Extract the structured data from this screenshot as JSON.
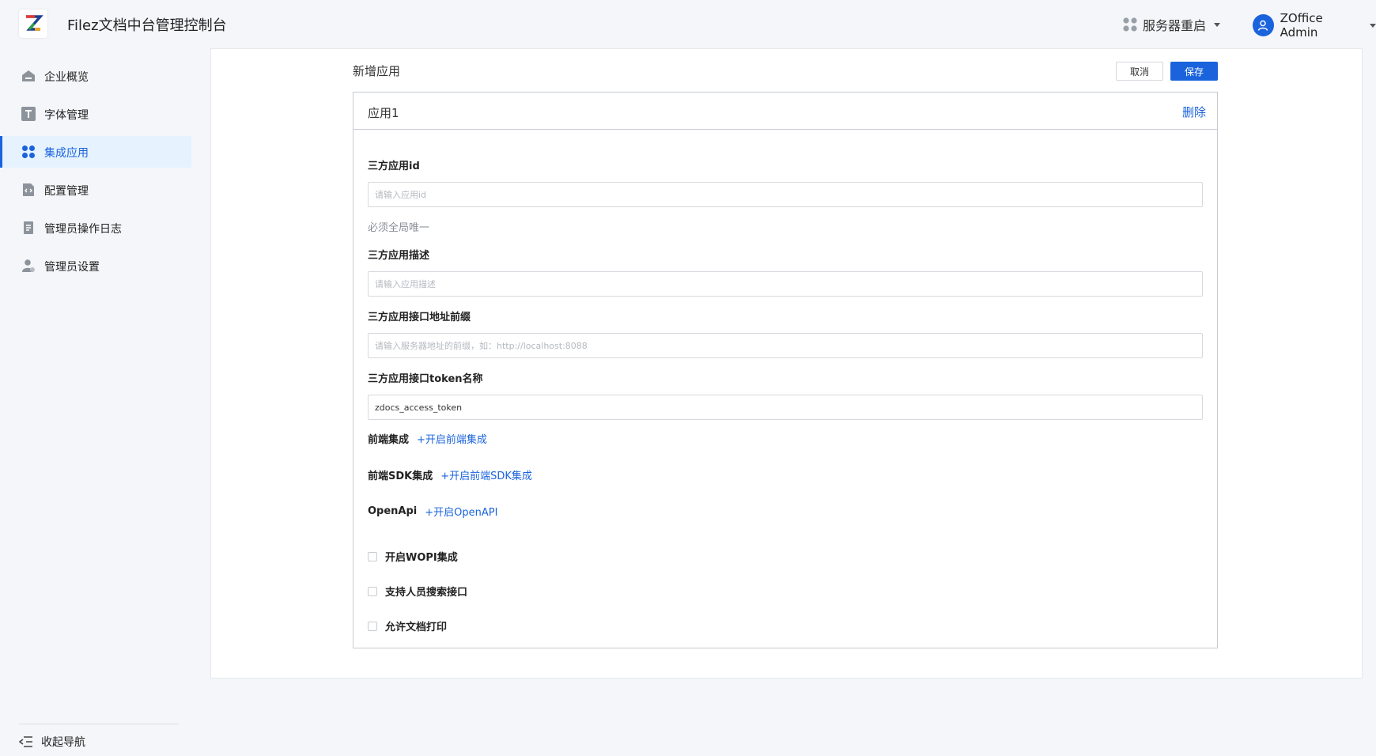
{
  "header": {
    "title": "Filez文档中台管理控制台",
    "restart_label": "服务器重启",
    "user_name": "ZOffice Admin"
  },
  "sidebar": {
    "items": [
      {
        "label": "企业概览",
        "icon": "building-icon"
      },
      {
        "label": "字体管理",
        "icon": "font-icon"
      },
      {
        "label": "集成应用",
        "icon": "apps-grid-icon",
        "active": true
      },
      {
        "label": "配置管理",
        "icon": "config-file-icon"
      },
      {
        "label": "管理员操作日志",
        "icon": "log-document-icon"
      },
      {
        "label": "管理员设置",
        "icon": "admin-user-icon"
      }
    ],
    "collapse_label": "收起导航"
  },
  "main": {
    "page_title": "新增应用",
    "cancel_label": "取消",
    "save_label": "保存",
    "card": {
      "title": "应用1",
      "delete_label": "删除",
      "fields": {
        "app_id": {
          "label": "三方应用id",
          "placeholder": "请输入应用id",
          "value": "",
          "hint": "必须全局唯一"
        },
        "app_desc": {
          "label": "三方应用描述",
          "placeholder": "请输入应用描述",
          "value": ""
        },
        "api_prefix": {
          "label": "三方应用接口地址前缀",
          "placeholder": "请输入服务器地址的前缀，如：http://localhost:8088",
          "value": ""
        },
        "token_name": {
          "label": "三方应用接口token名称",
          "placeholder": "",
          "value": "zdocs_access_token"
        }
      },
      "integrations": [
        {
          "label": "前端集成",
          "action": "+开启前端集成"
        },
        {
          "label": "前端SDK集成",
          "action": "+开启前端SDK集成"
        },
        {
          "label": "OpenApi",
          "action": "+开启OpenAPI"
        }
      ],
      "checkboxes": [
        {
          "label": "开启WOPI集成",
          "checked": false
        },
        {
          "label": "支持人员搜索接口",
          "checked": false
        },
        {
          "label": "允许文档打印",
          "checked": false
        }
      ]
    }
  },
  "colors": {
    "primary": "#1a63dc",
    "active_bg": "#e6f3ff",
    "page_bg": "#f4f6f9"
  }
}
